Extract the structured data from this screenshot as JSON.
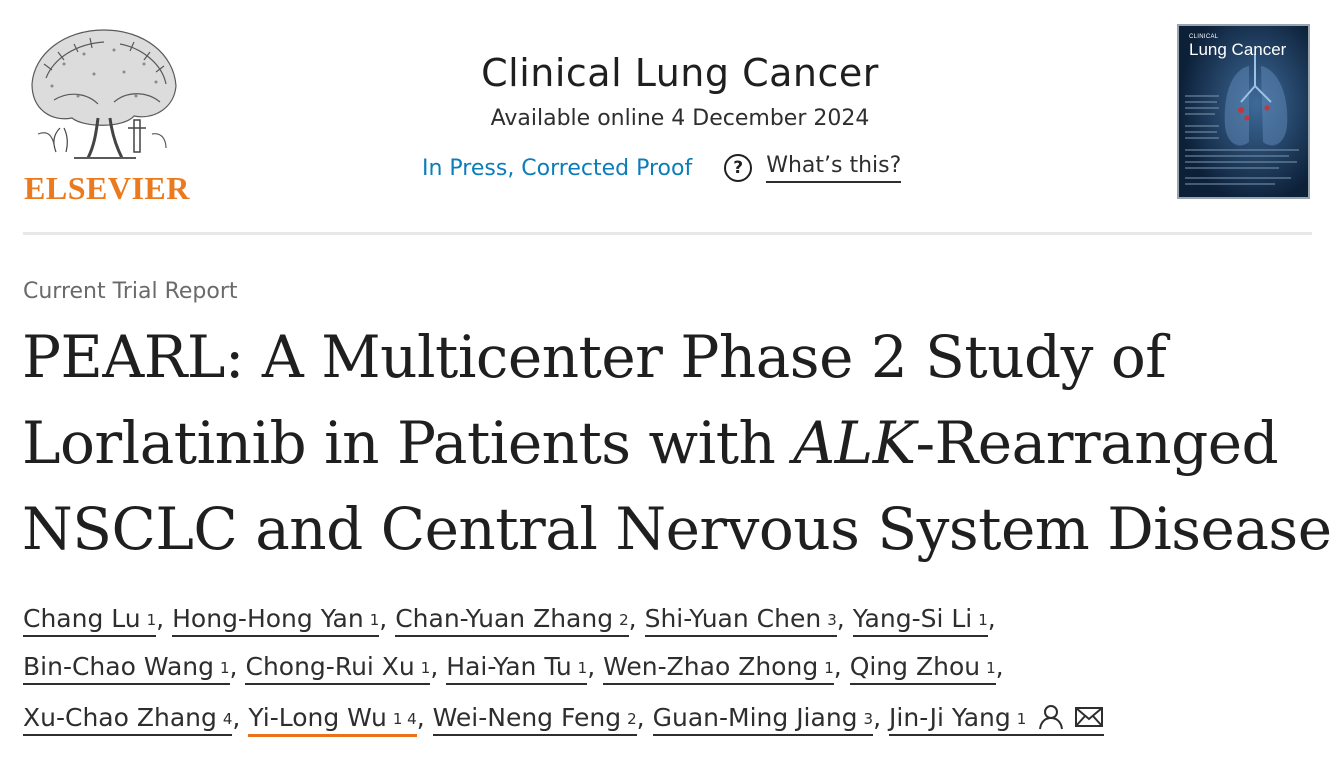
{
  "header": {
    "publisher": "ELSEVIER",
    "journal_title": "Clinical Lung Cancer",
    "available_online": "Available online 4 December 2024",
    "status": "In Press, Corrected Proof",
    "whats_this": "What’s this?",
    "cover": {
      "small": "CLINICAL",
      "title": "Lung Cancer"
    }
  },
  "article": {
    "type": "Current Trial Report",
    "title_line1": "PEARL: A Multicenter Phase 2 Study of",
    "title_line2_pre": "Lorlatinib in Patients with ",
    "title_line2_italic": "ALK",
    "title_line2_post": "-Rearranged",
    "title_line3": "NSCLC and Central Nervous System Disease"
  },
  "authors": [
    {
      "name": "Chang Lu",
      "aff": "1"
    },
    {
      "name": "Hong-Hong Yan",
      "aff": "1"
    },
    {
      "name": "Chan-Yuan Zhang",
      "aff": "2"
    },
    {
      "name": "Shi-Yuan Chen",
      "aff": "3"
    },
    {
      "name": "Yang-Si Li",
      "aff": "1"
    },
    {
      "name": "Bin-Chao Wang",
      "aff": "1"
    },
    {
      "name": "Chong-Rui Xu",
      "aff": "1"
    },
    {
      "name": "Hai-Yan Tu",
      "aff": "1"
    },
    {
      "name": "Wen-Zhao Zhong",
      "aff": "1"
    },
    {
      "name": "Qing Zhou",
      "aff": "1"
    },
    {
      "name": "Xu-Chao Zhang",
      "aff": "4"
    },
    {
      "name": "Yi-Long Wu",
      "aff": "1 4"
    },
    {
      "name": "Wei-Neng Feng",
      "aff": "2"
    },
    {
      "name": "Guan-Ming Jiang",
      "aff": "3"
    },
    {
      "name": "Jin-Ji Yang",
      "aff": "1"
    }
  ],
  "separator": ",",
  "colors": {
    "publisher_orange": "#ea7a1d",
    "link_blue": "#0c7dbb",
    "highlight_underline": "#e9711c",
    "cover_bg": "#0c2038"
  },
  "icons": {
    "help": "question-icon",
    "corresponding_author": "person-icon",
    "email": "mail-icon"
  }
}
